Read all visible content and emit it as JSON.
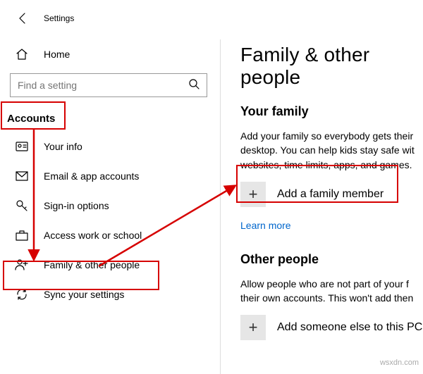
{
  "titlebar": {
    "title": "Settings"
  },
  "nav": {
    "home": "Home",
    "search_placeholder": "Find a setting",
    "category": "Accounts",
    "items": [
      {
        "label": "Your info"
      },
      {
        "label": "Email & app accounts"
      },
      {
        "label": "Sign-in options"
      },
      {
        "label": "Access work or school"
      },
      {
        "label": "Family & other people"
      },
      {
        "label": "Sync your settings"
      }
    ]
  },
  "main": {
    "heading": "Family & other people",
    "family_title": "Your family",
    "family_desc": "Add your family so everybody gets their desktop. You can help kids stay safe wit websites, time limits, apps, and games.",
    "add_family": "Add a family member",
    "learn_more": "Learn more",
    "other_title": "Other people",
    "other_desc": "Allow people who are not part of your f their own accounts. This won't add then",
    "add_other": "Add someone else to this PC"
  },
  "watermark": "wsxdn.com"
}
